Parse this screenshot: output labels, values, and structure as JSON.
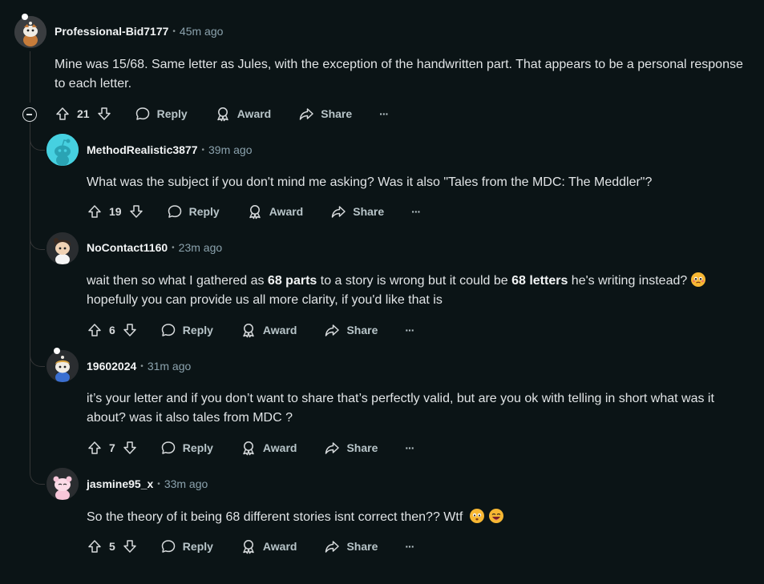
{
  "comments": [
    {
      "author": "Professional-Bid7177",
      "time": "45m ago",
      "body": "Mine was 15/68. Same letter as Jules, with the exception of the handwritten part. That appears to be a personal response to each letter.",
      "votes": "21",
      "avatar_icon": "snoo-avatar-icon"
    },
    {
      "author": "MethodRealistic3877",
      "time": "39m ago",
      "body": "What was the subject if you don't mind me asking? Was it also \"Tales from the MDC: The Meddler\"?",
      "votes": "19",
      "avatar_icon": "default-snoo-avatar-icon"
    },
    {
      "author": "NoContact1160",
      "time": "23m ago",
      "body_parts": [
        "wait then so what I gathered as ",
        "68 parts",
        " to a story is wrong but it could be ",
        "68 letters",
        " he's writing instead? ",
        " hopefully you can provide us all more clarity, if you'd like that is"
      ],
      "votes": "6",
      "avatar_icon": "snoo-avatar-icon"
    },
    {
      "author": "19602024",
      "time": "31m ago",
      "body": "it’s your letter and if you don’t want to share that’s perfectly valid, but are you ok with telling in short what was it about? was it also tales from MDC ?",
      "votes": "7",
      "avatar_icon": "snoo-avatar-icon"
    },
    {
      "author": "jasmine95_x",
      "time": "33m ago",
      "body": "So the theory of it being 68 different stories isnt correct then?? Wtf ",
      "votes": "5",
      "avatar_icon": "snoo-avatar-icon"
    }
  ],
  "actions": {
    "reply": "Reply",
    "award": "Award",
    "share": "Share",
    "more": "···"
  },
  "separator": "•",
  "colors": {
    "background": "#0b1416",
    "thread_line": "#343536",
    "author": "#f2f4f5",
    "time": "#8ba2ad",
    "body": "#e1e4e6",
    "action": "#b8c5c9",
    "default_avatar": "#46d0e0"
  }
}
